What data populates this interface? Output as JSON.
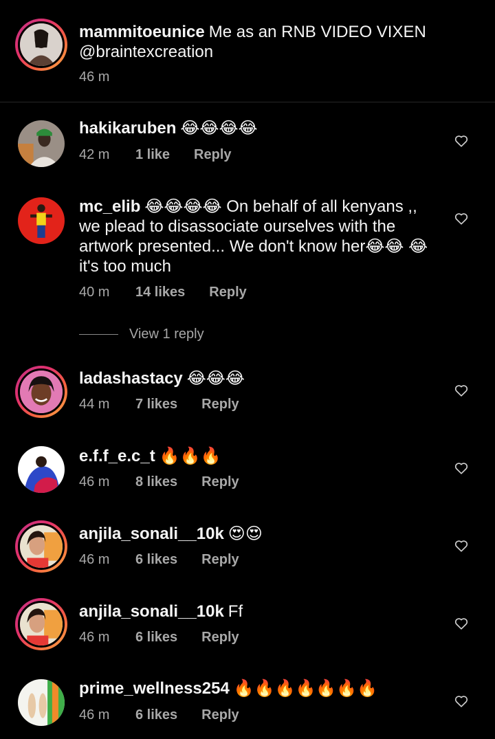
{
  "caption": {
    "username": "mammitoeunice",
    "text": "Me as an RNB VIDEO VIXEN @braintexcreation",
    "time": "46 m"
  },
  "comments": [
    {
      "username": "hakikaruben",
      "text": "😂😂😂😂",
      "time": "42 m",
      "likes": "1 like",
      "reply": "Reply"
    },
    {
      "username": "mc_elib",
      "text": "😂😂😂😂 On behalf of all kenyans ,, we plead to disassociate ourselves with the artwork presented... We don't know her😂😂 😂 it's too much",
      "time": "40 m",
      "likes": "14 likes",
      "reply": "Reply"
    },
    {
      "username": "ladashastacy",
      "text": "😂😂😂",
      "time": "44 m",
      "likes": "7 likes",
      "reply": "Reply"
    },
    {
      "username": "e.f.f_e.c_t",
      "text": "🔥🔥🔥",
      "time": "46 m",
      "likes": "8 likes",
      "reply": "Reply"
    },
    {
      "username": "anjila_sonali__10k",
      "text": "😍😍",
      "time": "46 m",
      "likes": "6 likes",
      "reply": "Reply"
    },
    {
      "username": "anjila_sonali__10k",
      "text": "Ff",
      "time": "46 m",
      "likes": "6 likes",
      "reply": "Reply"
    },
    {
      "username": "prime_wellness254",
      "text": "🔥🔥🔥🔥🔥🔥🔥",
      "time": "46 m",
      "likes": "6 likes",
      "reply": "Reply"
    }
  ],
  "view_replies": "View 1 reply",
  "icons": {
    "like": "heart-outline-icon"
  }
}
